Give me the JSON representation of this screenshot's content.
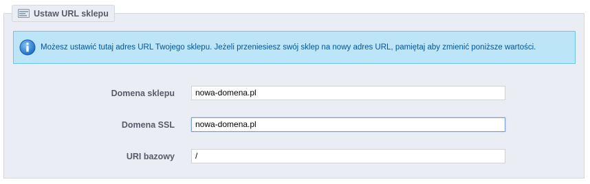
{
  "section": {
    "title": "Ustaw URL sklepu",
    "icon": "settings-panel-icon"
  },
  "info": {
    "icon": "info-icon",
    "text": "Możesz ustawić tutaj adres URL Twojego sklepu. Jeżeli przeniesiesz swój sklep na nowy adres URL, pamiętaj aby zmienić poniższe wartości."
  },
  "fields": [
    {
      "label": "Domena sklepu",
      "value": "nowa-domena.pl"
    },
    {
      "label": "Domena SSL",
      "value": "nowa-domena.pl"
    },
    {
      "label": "URI bazowy",
      "value": "/"
    }
  ],
  "colors": {
    "panel_bg": "#ebedf4",
    "info_bg": "#bde5f8",
    "info_border": "#6cc6ea",
    "info_text": "#00529b",
    "label_text": "#585a69"
  }
}
